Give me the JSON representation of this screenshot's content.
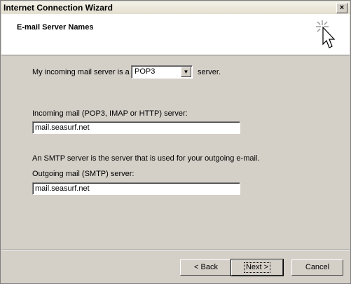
{
  "window": {
    "title": "Internet Connection Wizard",
    "close_glyph": "×"
  },
  "header": {
    "title": "E-mail Server Names",
    "icon": "wizard-cursor-icon"
  },
  "form": {
    "incoming_type": {
      "label_before": "My incoming mail server is a",
      "selected": "POP3",
      "label_after": "server."
    },
    "incoming": {
      "label": "Incoming mail (POP3, IMAP or HTTP) server:",
      "value": "mail.seasurf.net"
    },
    "smtp_note": "An SMTP server is the server that is used for your outgoing e-mail.",
    "outgoing": {
      "label": "Outgoing mail (SMTP) server:",
      "value": "mail.seasurf.net"
    }
  },
  "buttons": {
    "back": "< Back",
    "next": "Next >",
    "cancel": "Cancel"
  }
}
